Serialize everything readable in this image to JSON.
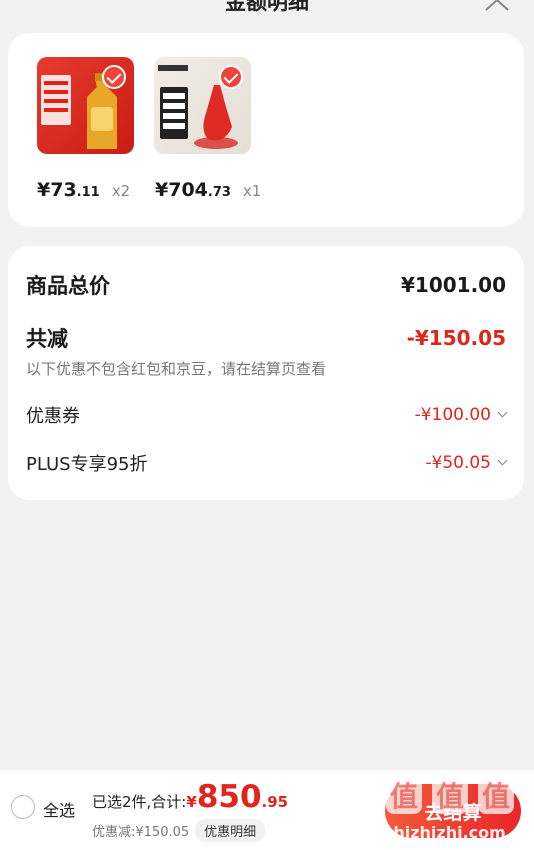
{
  "header": {
    "title": "金额明细"
  },
  "products": [
    {
      "price_main": "¥73",
      "price_dec": ".11",
      "qty": "x2"
    },
    {
      "price_main": "¥704",
      "price_dec": ".73",
      "qty": "x1"
    }
  ],
  "summary": {
    "total_label": "商品总价",
    "total_value": "¥1001.00",
    "reduce_label": "共减",
    "reduce_value": "-¥150.05",
    "note": "以下优惠不包含红包和京豆，请在结算页查看",
    "coupon_label": "优惠券",
    "coupon_value": "-¥100.00",
    "plus_label": "PLUS专享95折",
    "plus_value": "-¥50.05"
  },
  "footer": {
    "select_all": "全选",
    "selected_text": "已选2件,合计:",
    "currency": "¥",
    "total_main": "850",
    "total_dec": ".95",
    "discount_text": "优惠减:¥150.05",
    "discount_detail": "优惠明细",
    "checkout": "去结算"
  },
  "watermark": {
    "text": "值",
    "site": "zhizhizhi.com"
  },
  "colors": {
    "accent": "#e1251b",
    "background": "#f2f2f2",
    "card": "#ffffff"
  }
}
